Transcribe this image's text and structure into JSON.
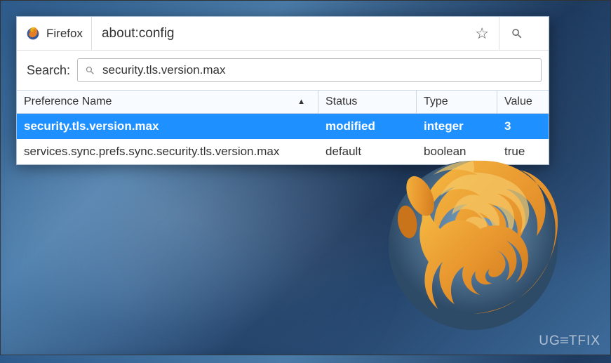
{
  "identity": {
    "label": "Firefox"
  },
  "addressbar": {
    "url": "about:config"
  },
  "search": {
    "label": "Search:",
    "value": "security.tls.version.max"
  },
  "table": {
    "headers": {
      "name": "Preference Name",
      "status": "Status",
      "type": "Type",
      "value": "Value"
    },
    "rows": [
      {
        "name": "security.tls.version.max",
        "status": "modified",
        "type": "integer",
        "value": "3",
        "selected": true
      },
      {
        "name": "services.sync.prefs.sync.security.tls.version.max",
        "status": "default",
        "type": "boolean",
        "value": "true",
        "selected": false
      }
    ]
  },
  "watermark": "UG=TFIX"
}
